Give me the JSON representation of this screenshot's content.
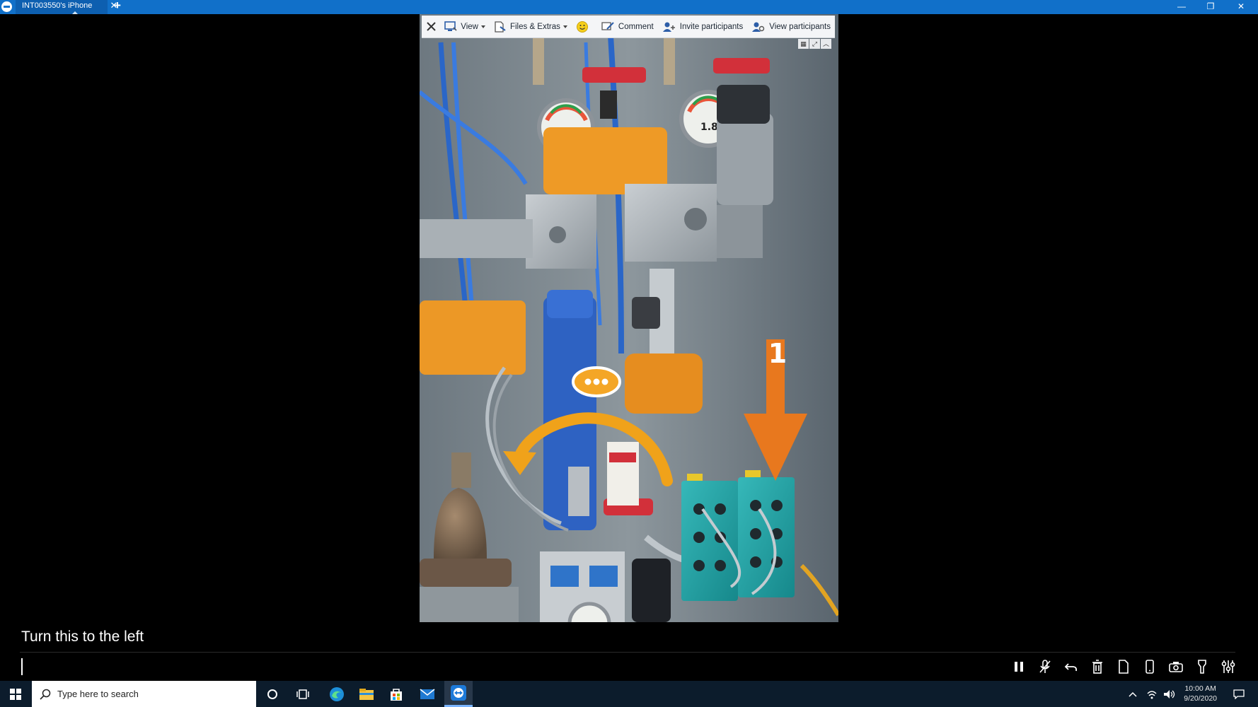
{
  "titlebar": {
    "tab_title": "INT003550's iPhone",
    "close_symbol": "✕",
    "new_tab_symbol": "+",
    "minimize_symbol": "—",
    "restore_symbol": "❐",
    "window_close_symbol": "✕"
  },
  "toolbar": {
    "view_label": "View",
    "files_label": "Files & Extras",
    "comment_label": "Comment",
    "invite_label": "Invite participants",
    "view_participants_label": "View participants"
  },
  "annotations": {
    "step_number": "1",
    "arrow_color": "#e8781e",
    "curve_color": "#f0a21a"
  },
  "chat": {
    "message": "Turn this to the left",
    "input_value": ""
  },
  "session_tools": [
    {
      "name": "pause-icon"
    },
    {
      "name": "microphone-muted-icon"
    },
    {
      "name": "undo-icon"
    },
    {
      "name": "trash-icon"
    },
    {
      "name": "document-icon"
    },
    {
      "name": "phone-icon"
    },
    {
      "name": "camera-icon"
    },
    {
      "name": "flashlight-icon"
    },
    {
      "name": "settings-sliders-icon"
    }
  ],
  "taskbar": {
    "search_placeholder": "Type here to search",
    "time": "10:00 AM",
    "date": "9/20/2020"
  },
  "colors": {
    "titlebar": "#1170c9",
    "taskbar": "#0c1c2c",
    "toolbar": "#f4f5f7"
  }
}
